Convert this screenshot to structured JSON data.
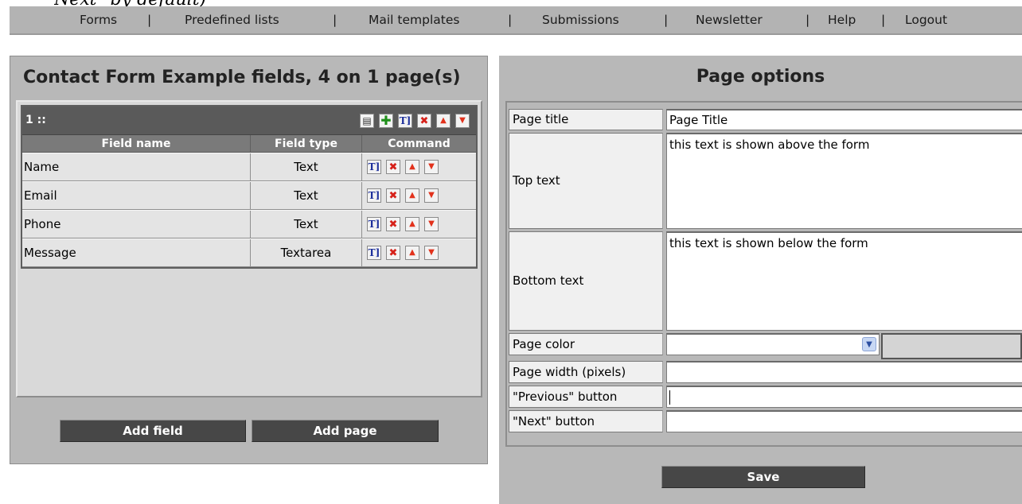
{
  "cutoff_text": "Next\" by default)",
  "nav": {
    "items": [
      "Forms",
      "Predefined lists",
      "Mail templates",
      "Submissions",
      "Newsletter",
      "Help",
      "Logout"
    ],
    "separator": "|"
  },
  "left": {
    "title": "Contact Form Example fields, 4 on 1 page(s)",
    "page_label": "1 ::",
    "columns": [
      "Field name",
      "Field type",
      "Command"
    ],
    "rows": [
      {
        "name": "Name",
        "type": "Text"
      },
      {
        "name": "Email",
        "type": "Text"
      },
      {
        "name": "Phone",
        "type": "Text"
      },
      {
        "name": "Message",
        "type": "Textarea"
      }
    ],
    "add_field_label": "Add field",
    "add_page_label": "Add page"
  },
  "right": {
    "title": "Page options",
    "page_title_label": "Page title",
    "page_title_value": "Page Title",
    "top_text_label": "Top text",
    "top_text_value": "this text is shown above the form",
    "bottom_text_label": "Bottom text",
    "bottom_text_value": "this text is shown below the form",
    "page_color_label": "Page color",
    "page_color_value": "",
    "page_width_label": "Page width (pixels)",
    "page_width_value": "",
    "previous_label": "\"Previous\" button",
    "previous_value": "",
    "next_label": "\"Next\" button",
    "next_value": "",
    "save_label": "Save"
  },
  "icons": {
    "edit": "edit-field-icon",
    "delete": "delete-icon",
    "up": "move-up-icon",
    "down": "move-down-icon",
    "add": "add-field-icon",
    "props": "page-properties-icon"
  },
  "colors": {
    "nav_bg": "#b3b3b3",
    "panel_bg": "#b8b8b8",
    "header_bar": "#5a5a5a",
    "button_bg": "#474747"
  }
}
